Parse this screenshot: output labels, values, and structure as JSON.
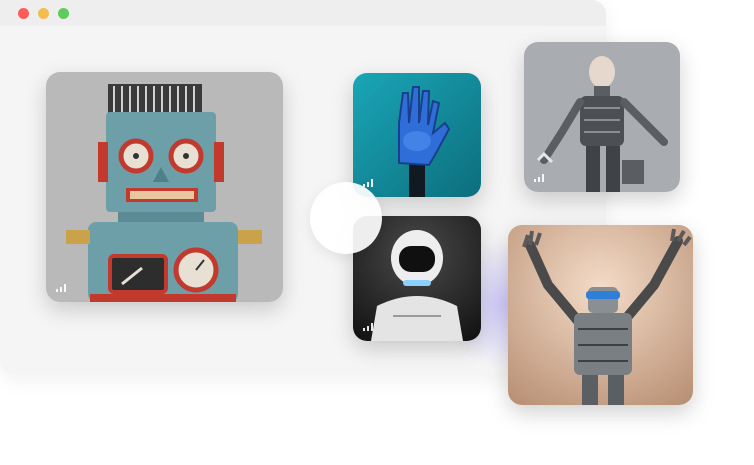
{
  "window": {
    "controls": [
      {
        "name": "close",
        "color": "#fc5d57"
      },
      {
        "name": "minimize",
        "color": "#f5bd4f"
      },
      {
        "name": "zoom",
        "color": "#5fcb5d"
      }
    ]
  },
  "tiles": [
    {
      "subject": "tin-robot",
      "icon": "signal-icon"
    },
    {
      "subject": "robotic-hand",
      "icon": "signal-icon"
    },
    {
      "subject": "white-humanoid-robot",
      "icon": "signal-icon"
    },
    {
      "subject": "android-figure",
      "icon": "signal-icon"
    },
    {
      "subject": "robot-arms-raised",
      "icon": "none"
    }
  ],
  "colors": {
    "accent_glow": "#aea6ff",
    "window_bg": "#f5f5f5",
    "titlebar_bg": "#eeeeee"
  }
}
